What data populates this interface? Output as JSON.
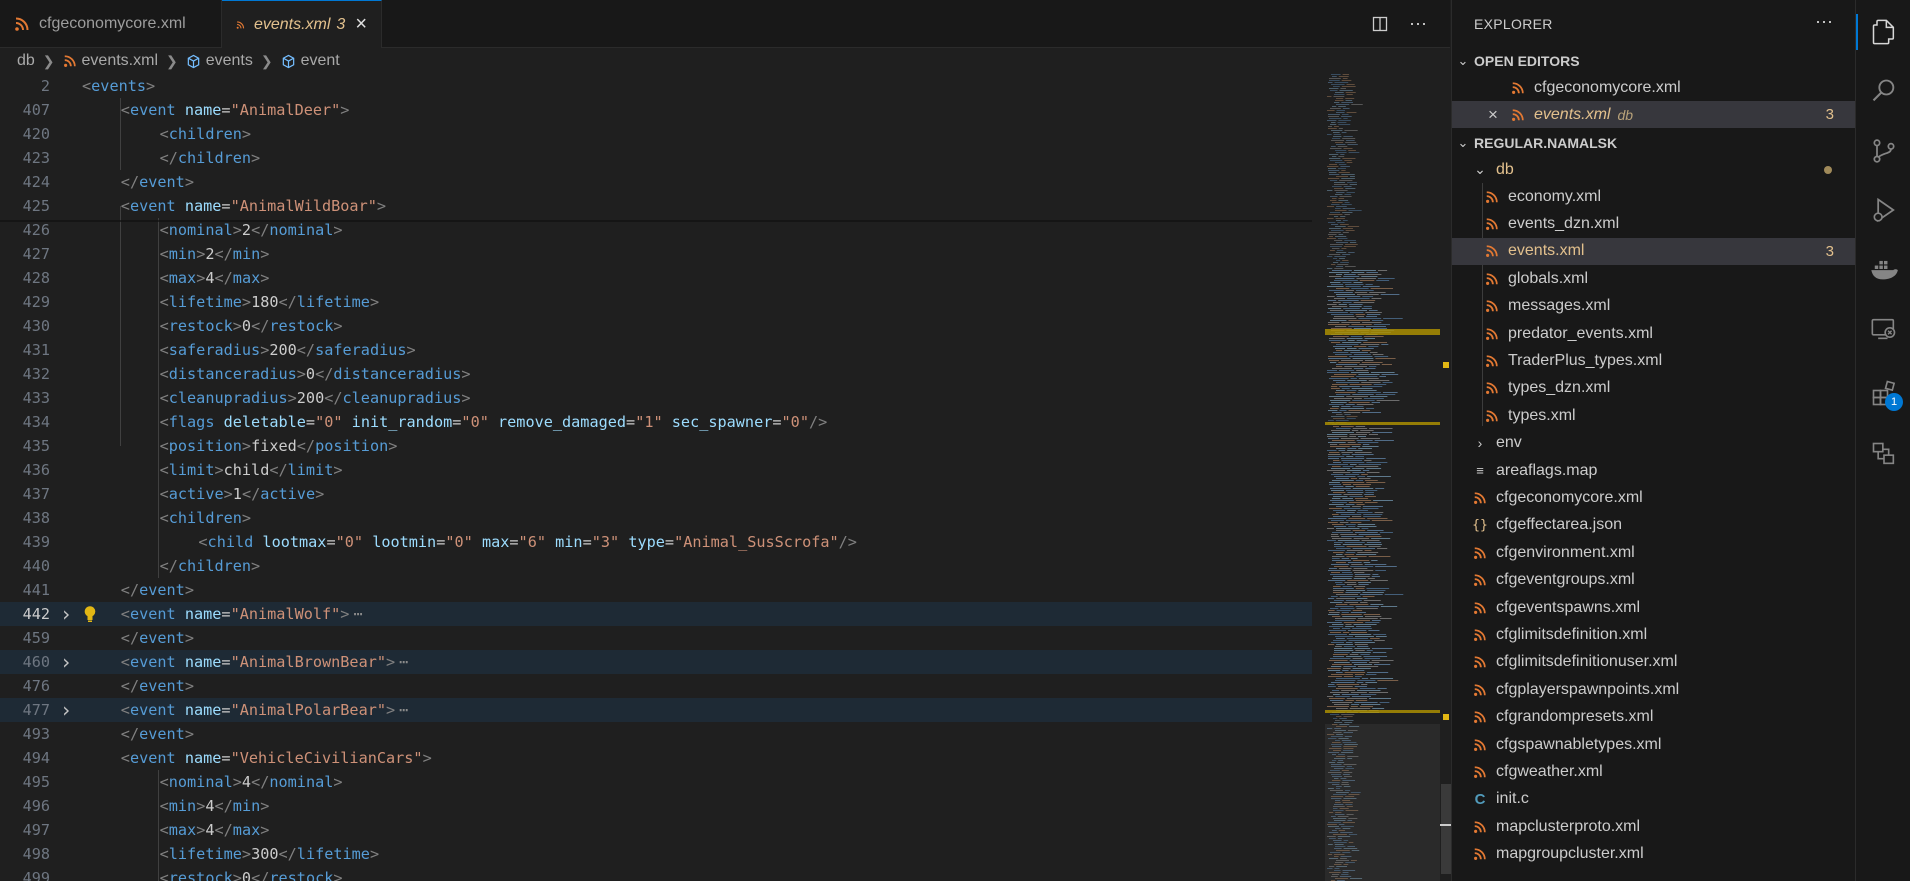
{
  "tabs": [
    {
      "label": "cfgeconomycore.xml",
      "active": false
    },
    {
      "label": "events.xml",
      "active": true,
      "problems": "3"
    }
  ],
  "breadcrumbs": [
    "db",
    "events.xml",
    "events",
    "event"
  ],
  "code_lines": [
    {
      "n": "2",
      "tokens": [
        [
          "pu",
          "<"
        ],
        [
          "tg",
          "events"
        ],
        [
          "pu",
          ">"
        ]
      ],
      "indent": 0
    },
    {
      "n": "407",
      "tokens": [
        [
          "pu",
          "<"
        ],
        [
          "tg",
          "event"
        ],
        [
          "txt",
          " "
        ],
        [
          "at",
          "name"
        ],
        [
          "txt",
          "="
        ],
        [
          "st",
          "\"AnimalDeer\""
        ],
        [
          "pu",
          ">"
        ]
      ],
      "indent": 1
    },
    {
      "n": "420",
      "tokens": [
        [
          "pu",
          "<"
        ],
        [
          "tg",
          "children"
        ],
        [
          "pu",
          ">"
        ]
      ],
      "indent": 2
    },
    {
      "n": "423",
      "tokens": [
        [
          "pu",
          "</"
        ],
        [
          "tg",
          "children"
        ],
        [
          "pu",
          ">"
        ]
      ],
      "indent": 2
    },
    {
      "n": "424",
      "tokens": [
        [
          "pu",
          "</"
        ],
        [
          "tg",
          "event"
        ],
        [
          "pu",
          ">"
        ]
      ],
      "indent": 1
    },
    {
      "n": "425",
      "tokens": [
        [
          "pu",
          "<"
        ],
        [
          "tg",
          "event"
        ],
        [
          "txt",
          " "
        ],
        [
          "at",
          "name"
        ],
        [
          "txt",
          "="
        ],
        [
          "st",
          "\"AnimalWildBoar\""
        ],
        [
          "pu",
          ">"
        ]
      ],
      "indent": 1
    },
    {
      "n": "426",
      "tokens": [
        [
          "pu",
          "<"
        ],
        [
          "tg",
          "nominal"
        ],
        [
          "pu",
          ">"
        ],
        [
          "txt",
          "2"
        ],
        [
          "pu",
          "</"
        ],
        [
          "tg",
          "nominal"
        ],
        [
          "pu",
          ">"
        ]
      ],
      "indent": 2
    },
    {
      "n": "427",
      "tokens": [
        [
          "pu",
          "<"
        ],
        [
          "tg",
          "min"
        ],
        [
          "pu",
          ">"
        ],
        [
          "txt",
          "2"
        ],
        [
          "pu",
          "</"
        ],
        [
          "tg",
          "min"
        ],
        [
          "pu",
          ">"
        ]
      ],
      "indent": 2
    },
    {
      "n": "428",
      "tokens": [
        [
          "pu",
          "<"
        ],
        [
          "tg",
          "max"
        ],
        [
          "pu",
          ">"
        ],
        [
          "txt",
          "4"
        ],
        [
          "pu",
          "</"
        ],
        [
          "tg",
          "max"
        ],
        [
          "pu",
          ">"
        ]
      ],
      "indent": 2
    },
    {
      "n": "429",
      "tokens": [
        [
          "pu",
          "<"
        ],
        [
          "tg",
          "lifetime"
        ],
        [
          "pu",
          ">"
        ],
        [
          "txt",
          "180"
        ],
        [
          "pu",
          "</"
        ],
        [
          "tg",
          "lifetime"
        ],
        [
          "pu",
          ">"
        ]
      ],
      "indent": 2
    },
    {
      "n": "430",
      "tokens": [
        [
          "pu",
          "<"
        ],
        [
          "tg",
          "restock"
        ],
        [
          "pu",
          ">"
        ],
        [
          "txt",
          "0"
        ],
        [
          "pu",
          "</"
        ],
        [
          "tg",
          "restock"
        ],
        [
          "pu",
          ">"
        ]
      ],
      "indent": 2
    },
    {
      "n": "431",
      "tokens": [
        [
          "pu",
          "<"
        ],
        [
          "tg",
          "saferadius"
        ],
        [
          "pu",
          ">"
        ],
        [
          "txt",
          "200"
        ],
        [
          "pu",
          "</"
        ],
        [
          "tg",
          "saferadius"
        ],
        [
          "pu",
          ">"
        ]
      ],
      "indent": 2
    },
    {
      "n": "432",
      "tokens": [
        [
          "pu",
          "<"
        ],
        [
          "tg",
          "distanceradius"
        ],
        [
          "pu",
          ">"
        ],
        [
          "txt",
          "0"
        ],
        [
          "pu",
          "</"
        ],
        [
          "tg",
          "distanceradius"
        ],
        [
          "pu",
          ">"
        ]
      ],
      "indent": 2
    },
    {
      "n": "433",
      "tokens": [
        [
          "pu",
          "<"
        ],
        [
          "tg",
          "cleanupradius"
        ],
        [
          "pu",
          ">"
        ],
        [
          "txt",
          "200"
        ],
        [
          "pu",
          "</"
        ],
        [
          "tg",
          "cleanupradius"
        ],
        [
          "pu",
          ">"
        ]
      ],
      "indent": 2
    },
    {
      "n": "434",
      "tokens": [
        [
          "pu",
          "<"
        ],
        [
          "tg",
          "flags"
        ],
        [
          "txt",
          " "
        ],
        [
          "at",
          "deletable"
        ],
        [
          "txt",
          "="
        ],
        [
          "st",
          "\"0\""
        ],
        [
          "txt",
          " "
        ],
        [
          "at",
          "init_random"
        ],
        [
          "txt",
          "="
        ],
        [
          "st",
          "\"0\""
        ],
        [
          "txt",
          " "
        ],
        [
          "at",
          "remove_damaged"
        ],
        [
          "txt",
          "="
        ],
        [
          "st",
          "\"1\""
        ],
        [
          "txt",
          " "
        ],
        [
          "at",
          "sec_spawner"
        ],
        [
          "txt",
          "="
        ],
        [
          "st",
          "\"0\""
        ],
        [
          "pu",
          "/>"
        ]
      ],
      "indent": 2
    },
    {
      "n": "435",
      "tokens": [
        [
          "pu",
          "<"
        ],
        [
          "tg",
          "position"
        ],
        [
          "pu",
          ">"
        ],
        [
          "txt",
          "fixed"
        ],
        [
          "pu",
          "</"
        ],
        [
          "tg",
          "position"
        ],
        [
          "pu",
          ">"
        ]
      ],
      "indent": 2
    },
    {
      "n": "436",
      "tokens": [
        [
          "pu",
          "<"
        ],
        [
          "tg",
          "limit"
        ],
        [
          "pu",
          ">"
        ],
        [
          "txt",
          "child"
        ],
        [
          "pu",
          "</"
        ],
        [
          "tg",
          "limit"
        ],
        [
          "pu",
          ">"
        ]
      ],
      "indent": 2
    },
    {
      "n": "437",
      "tokens": [
        [
          "pu",
          "<"
        ],
        [
          "tg",
          "active"
        ],
        [
          "pu",
          ">"
        ],
        [
          "txt",
          "1"
        ],
        [
          "pu",
          "</"
        ],
        [
          "tg",
          "active"
        ],
        [
          "pu",
          ">"
        ]
      ],
      "indent": 2
    },
    {
      "n": "438",
      "tokens": [
        [
          "pu",
          "<"
        ],
        [
          "tg",
          "children"
        ],
        [
          "pu",
          ">"
        ]
      ],
      "indent": 2
    },
    {
      "n": "439",
      "tokens": [
        [
          "pu",
          "<"
        ],
        [
          "tg",
          "child"
        ],
        [
          "txt",
          " "
        ],
        [
          "at",
          "lootmax"
        ],
        [
          "txt",
          "="
        ],
        [
          "st",
          "\"0\""
        ],
        [
          "txt",
          " "
        ],
        [
          "at",
          "lootmin"
        ],
        [
          "txt",
          "="
        ],
        [
          "st",
          "\"0\""
        ],
        [
          "txt",
          " "
        ],
        [
          "at",
          "max"
        ],
        [
          "txt",
          "="
        ],
        [
          "st",
          "\"6\""
        ],
        [
          "txt",
          " "
        ],
        [
          "at",
          "min"
        ],
        [
          "txt",
          "="
        ],
        [
          "st",
          "\"3\""
        ],
        [
          "txt",
          " "
        ],
        [
          "at",
          "type"
        ],
        [
          "txt",
          "="
        ],
        [
          "st",
          "\"Animal_SusScrofa\""
        ],
        [
          "pu",
          "/>"
        ]
      ],
      "indent": 3
    },
    {
      "n": "440",
      "tokens": [
        [
          "pu",
          "</"
        ],
        [
          "tg",
          "children"
        ],
        [
          "pu",
          ">"
        ]
      ],
      "indent": 2
    },
    {
      "n": "441",
      "tokens": [
        [
          "pu",
          "</"
        ],
        [
          "tg",
          "event"
        ],
        [
          "pu",
          ">"
        ]
      ],
      "indent": 1
    },
    {
      "n": "442",
      "tokens": [
        [
          "pu",
          "<"
        ],
        [
          "tg",
          "event"
        ],
        [
          "txt",
          " "
        ],
        [
          "at",
          "name"
        ],
        [
          "txt",
          "="
        ],
        [
          "st",
          "\"AnimalWolf\""
        ],
        [
          "pu",
          ">"
        ]
      ],
      "indent": 1,
      "folded": true,
      "current": true,
      "bulb": true
    },
    {
      "n": "459",
      "tokens": [
        [
          "pu",
          "</"
        ],
        [
          "tg",
          "event"
        ],
        [
          "pu",
          ">"
        ]
      ],
      "indent": 1
    },
    {
      "n": "460",
      "tokens": [
        [
          "pu",
          "<"
        ],
        [
          "tg",
          "event"
        ],
        [
          "txt",
          " "
        ],
        [
          "at",
          "name"
        ],
        [
          "txt",
          "="
        ],
        [
          "st",
          "\"AnimalBrownBear\""
        ],
        [
          "pu",
          ">"
        ]
      ],
      "indent": 1,
      "folded": true
    },
    {
      "n": "476",
      "tokens": [
        [
          "pu",
          "</"
        ],
        [
          "tg",
          "event"
        ],
        [
          "pu",
          ">"
        ]
      ],
      "indent": 1
    },
    {
      "n": "477",
      "tokens": [
        [
          "pu",
          "<"
        ],
        [
          "tg",
          "event"
        ],
        [
          "txt",
          " "
        ],
        [
          "at",
          "name"
        ],
        [
          "txt",
          "="
        ],
        [
          "st",
          "\"AnimalPolarBear\""
        ],
        [
          "pu",
          ">"
        ]
      ],
      "indent": 1,
      "folded": true
    },
    {
      "n": "493",
      "tokens": [
        [
          "pu",
          "</"
        ],
        [
          "tg",
          "event"
        ],
        [
          "pu",
          ">"
        ]
      ],
      "indent": 1
    },
    {
      "n": "494",
      "tokens": [
        [
          "pu",
          "<"
        ],
        [
          "tg",
          "event"
        ],
        [
          "txt",
          " "
        ],
        [
          "at",
          "name"
        ],
        [
          "txt",
          "="
        ],
        [
          "st",
          "\"VehicleCivilianCars\""
        ],
        [
          "pu",
          ">"
        ]
      ],
      "indent": 1
    },
    {
      "n": "495",
      "tokens": [
        [
          "pu",
          "<"
        ],
        [
          "tg",
          "nominal"
        ],
        [
          "pu",
          ">"
        ],
        [
          "txt",
          "4"
        ],
        [
          "pu",
          "</"
        ],
        [
          "tg",
          "nominal"
        ],
        [
          "pu",
          ">"
        ]
      ],
      "indent": 2
    },
    {
      "n": "496",
      "tokens": [
        [
          "pu",
          "<"
        ],
        [
          "tg",
          "min"
        ],
        [
          "pu",
          ">"
        ],
        [
          "txt",
          "4"
        ],
        [
          "pu",
          "</"
        ],
        [
          "tg",
          "min"
        ],
        [
          "pu",
          ">"
        ]
      ],
      "indent": 2
    },
    {
      "n": "497",
      "tokens": [
        [
          "pu",
          "<"
        ],
        [
          "tg",
          "max"
        ],
        [
          "pu",
          ">"
        ],
        [
          "txt",
          "4"
        ],
        [
          "pu",
          "</"
        ],
        [
          "tg",
          "max"
        ],
        [
          "pu",
          ">"
        ]
      ],
      "indent": 2
    },
    {
      "n": "498",
      "tokens": [
        [
          "pu",
          "<"
        ],
        [
          "tg",
          "lifetime"
        ],
        [
          "pu",
          ">"
        ],
        [
          "txt",
          "300"
        ],
        [
          "pu",
          "</"
        ],
        [
          "tg",
          "lifetime"
        ],
        [
          "pu",
          ">"
        ]
      ],
      "indent": 2
    },
    {
      "n": "499",
      "tokens": [
        [
          "pu",
          "<"
        ],
        [
          "tg",
          "restock"
        ],
        [
          "pu",
          ">"
        ],
        [
          "txt",
          "0"
        ],
        [
          "pu",
          "</"
        ],
        [
          "tg",
          "restock"
        ],
        [
          "pu",
          ">"
        ]
      ],
      "indent": 2
    }
  ],
  "fold_ellipsis": "⋯",
  "sidebar": {
    "title": "EXPLORER",
    "open_editors": {
      "label": "OPEN EDITORS",
      "items": [
        {
          "name": "cfgeconomycore.xml"
        },
        {
          "name": "events.xml",
          "folder": "db",
          "problems": "3"
        }
      ]
    },
    "workspace": {
      "label": "REGULAR.NAMALSK",
      "db_folder": "db",
      "db_files": [
        {
          "name": "economy.xml"
        },
        {
          "name": "events_dzn.xml"
        },
        {
          "name": "events.xml",
          "problems": "3"
        },
        {
          "name": "globals.xml"
        },
        {
          "name": "messages.xml"
        },
        {
          "name": "predator_events.xml"
        },
        {
          "name": "TraderPlus_types.xml"
        },
        {
          "name": "types_dzn.xml"
        },
        {
          "name": "types.xml"
        }
      ],
      "env_folder": "env",
      "root_files": [
        {
          "name": "areaflags.map",
          "icon": "lines-icon"
        },
        {
          "name": "cfgeconomycore.xml",
          "icon": "rss-icon"
        },
        {
          "name": "cfgeffectarea.json",
          "icon": "braces-icon"
        },
        {
          "name": "cfgenvironment.xml",
          "icon": "rss-icon"
        },
        {
          "name": "cfgeventgroups.xml",
          "icon": "rss-icon"
        },
        {
          "name": "cfgeventspawns.xml",
          "icon": "rss-icon"
        },
        {
          "name": "cfglimitsdefinition.xml",
          "icon": "rss-icon"
        },
        {
          "name": "cfglimitsdefinitionuser.xml",
          "icon": "rss-icon"
        },
        {
          "name": "cfgplayerspawnpoints.xml",
          "icon": "rss-icon"
        },
        {
          "name": "cfgrandompresets.xml",
          "icon": "rss-icon"
        },
        {
          "name": "cfgspawnabletypes.xml",
          "icon": "rss-icon"
        },
        {
          "name": "cfgweather.xml",
          "icon": "rss-icon"
        },
        {
          "name": "init.c",
          "icon": "c-icon"
        },
        {
          "name": "mapclusterproto.xml",
          "icon": "rss-icon"
        },
        {
          "name": "mapgroupcluster.xml",
          "icon": "rss-icon"
        }
      ]
    }
  },
  "activity_bar": [
    {
      "name": "explorer-icon",
      "active": true
    },
    {
      "name": "search-icon"
    },
    {
      "name": "source-control-icon"
    },
    {
      "name": "run-debug-icon"
    },
    {
      "name": "docker-icon"
    },
    {
      "name": "remote-explorer-icon"
    },
    {
      "name": "extensions-icon",
      "badge": "1"
    },
    {
      "name": "extensions-misc-icon"
    }
  ],
  "colors": {
    "accent": "#0078d4",
    "warning": "#e2c08d",
    "tag": "#569cd6",
    "attribute": "#9cdcfe",
    "string": "#ce9178",
    "rss_orange": "#e37933"
  }
}
